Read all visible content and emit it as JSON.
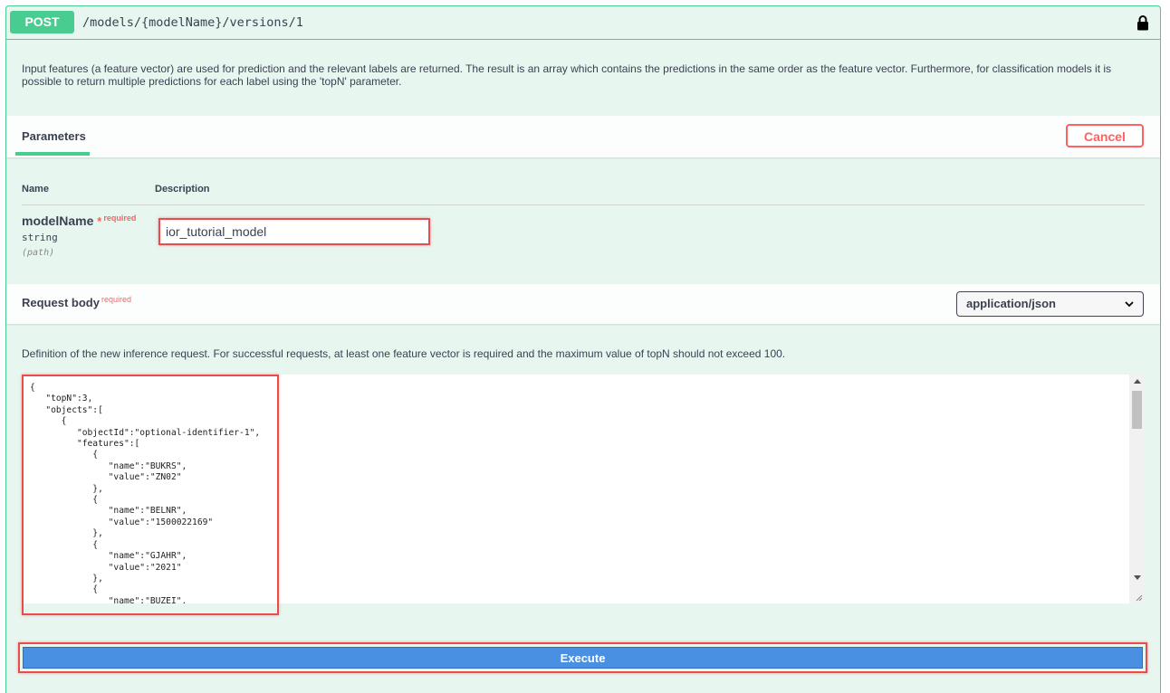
{
  "operation": {
    "method": "POST",
    "path": "/models/{modelName}/versions/1",
    "description": "Input features (a feature vector) are used for prediction and the relevant labels are returned. The result is an array which contains the predictions in the same order as the feature vector. Furthermore, for classification models it is possible to return multiple predictions for each label using the 'topN' parameter.",
    "lock_icon": "lock-icon"
  },
  "parameters": {
    "tab_label": "Parameters",
    "cancel_label": "Cancel",
    "col_name": "Name",
    "col_description": "Description",
    "param": {
      "name": "modelName",
      "required_star": "*",
      "required_label": "required",
      "type": "string",
      "location": "(path)",
      "value": "ior_tutorial_model"
    }
  },
  "request_body": {
    "title": "Request body",
    "required_label": "required",
    "content_type": "application/json",
    "description": "Definition of the new inference request. For successful requests, at least one feature vector is required and the maximum value of topN should not exceed 100.",
    "code": "{\n   \"topN\":3,\n   \"objects\":[\n      {\n         \"objectId\":\"optional-identifier-1\",\n         \"features\":[\n            {\n               \"name\":\"BUKRS\",\n               \"value\":\"ZN02\"\n            },\n            {\n               \"name\":\"BELNR\",\n               \"value\":\"1500022169\"\n            },\n            {\n               \"name\":\"GJAHR\",\n               \"value\":\"2021\"\n            },\n            {\n               \"name\":\"BUZEI\","
  },
  "execute_label": "Execute",
  "colors": {
    "post_green": "#49cc90",
    "highlight_red": "#e84c4c",
    "execute_blue": "#4990e2",
    "cancel_red": "#ff6060"
  }
}
